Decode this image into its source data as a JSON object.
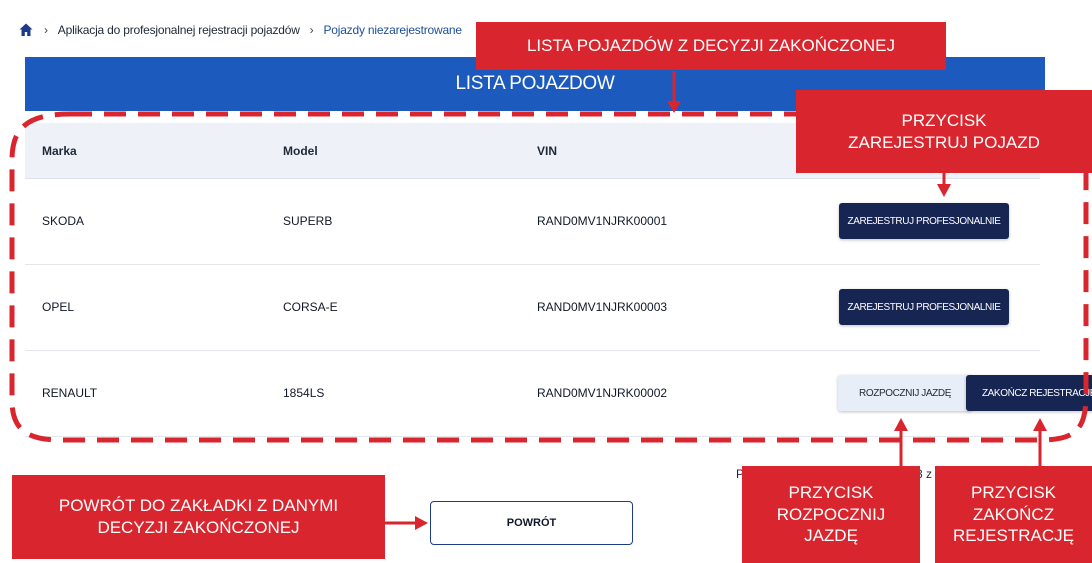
{
  "breadcrumb": {
    "items": [
      "Aplikacja do profesjonalnej rejestracji pojazdów",
      "Pojazdy niezarejestrowane"
    ]
  },
  "banner": {
    "title": "LISTA POJAZDOW"
  },
  "table": {
    "headers": [
      "Marka",
      "Model",
      "VIN"
    ],
    "rows": [
      {
        "marka": "SKODA",
        "model": "SUPERB",
        "vin": "RAND0MV1NJRK00001",
        "action": "ZAREJESTRUJ PROFESJONALNIE"
      },
      {
        "marka": "OPEL",
        "model": "CORSA-E",
        "vin": "RAND0MV1NJRK00003",
        "action": "ZAREJESTRUJ PROFESJONALNIE"
      },
      {
        "marka": "RENAULT",
        "model": "1854LS",
        "vin": "RAND0MV1NJRK00002",
        "action_start": "ROZPOCZNIJ JAZDĘ",
        "action_end": "ZAKOŃCZ REJESTRACJĘ"
      }
    ]
  },
  "pagination": {
    "fragment_left": "P",
    "fragment_right": "3 z"
  },
  "back_button": {
    "label": "POWRÓT"
  },
  "callouts": {
    "list": "LISTA POJAZDÓW Z DECYZJI ZAKOŃCZONEJ",
    "register_line1": "PRZYCISK",
    "register_line2": "ZAREJESTRUJ POJAZD",
    "back_line1": "POWRÓT DO ZAKŁADKI Z DANYMI",
    "back_line2": "DECYZJI ZAKOŃCZONEJ",
    "start_line1": "PRZYCISK",
    "start_line2": "ROZPOCZNIJ",
    "start_line3": "JAZDĘ",
    "end_line1": "PRZYCISK",
    "end_line2": "ZAKOŃCZ",
    "end_line3": "REJESTRACJĘ"
  },
  "colors": {
    "banner": "#1c5bbd",
    "dark_button": "#172553",
    "callout_red": "#d9252e",
    "annotation_dash": "#d9252e"
  }
}
